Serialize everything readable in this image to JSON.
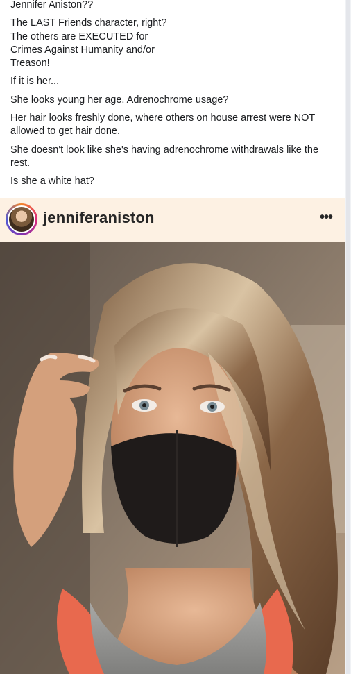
{
  "post": {
    "paragraphs": [
      "Jennifer Aniston??",
      "The LAST Friends character, right?\nThe others are EXECUTED for\nCrimes Against Humanity and/or\nTreason!",
      "If it is her...",
      "She looks young her age. Adrenochrome usage?",
      "Her hair looks freshly done, where others on house arrest were NOT allowed to get hair done.",
      "She doesn't look like she's having adrenochrome withdrawals like the rest.",
      "Is she a white hat?"
    ]
  },
  "instagram": {
    "username": "jenniferaniston",
    "more_icon": "more-horizontal-icon",
    "more_glyph": "•••",
    "avatar_icon": "profile-avatar",
    "photo": "selfie-black-face-mask"
  },
  "colors": {
    "text": "#1c1e21",
    "embed_bg": "#fdf1e3",
    "username": "#262626"
  }
}
